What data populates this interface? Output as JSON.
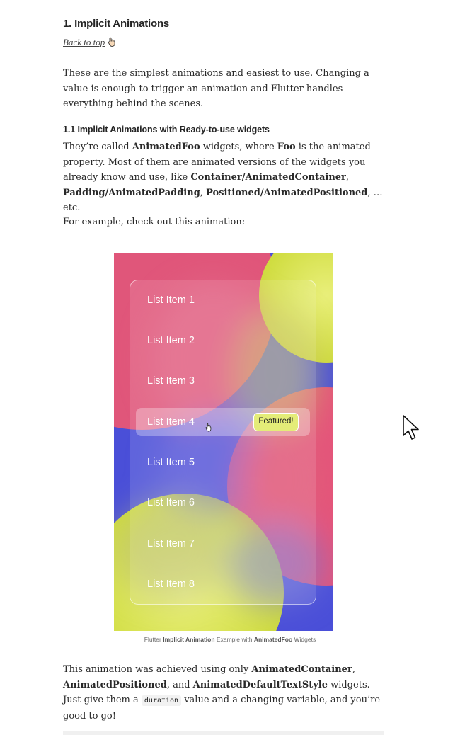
{
  "section": {
    "heading": "1. Implicit Animations",
    "back_to_top": "Back to top",
    "intro": "These are the simplest animations and easiest to use. Changing a value is enough to trigger an animation and Flutter handles everything behind the scenes.",
    "subheading": "1.1 Implicit Animations with Ready-to-use widgets",
    "p1": {
      "t1": "They’re called ",
      "b1": "AnimatedFoo",
      "t2": " widgets, where ",
      "b2": "Foo",
      "t3": " is the animated property. Most of them are animated versions of the widgets you already know and use, like ",
      "b3": "Container/AnimatedContainer",
      "t4": ", ",
      "b4": "Padding/AnimatedPadding",
      "t5": ", ",
      "b5": "Positioned/AnimatedPositioned",
      "t6": ", …etc."
    },
    "p2": "For example, check out this animation:",
    "demo": {
      "items": [
        "List Item 1",
        "List Item 2",
        "List Item 3",
        "List Item 4",
        "List Item 5",
        "List Item 6",
        "List Item 7",
        "List Item 8"
      ],
      "featured_label": "Featured!"
    },
    "caption": {
      "t1": "Flutter ",
      "b1": "Implicit Animation",
      "t2": " Example with ",
      "b2": "AnimatedFoo",
      "t3": " Widgets"
    },
    "p3": {
      "t1": "This animation was achieved using only ",
      "b1": "AnimatedContainer",
      "t2": ", ",
      "b2": "AnimatedPositioned",
      "t3": ", and ",
      "b3": "AnimatedDefaultTextStyle",
      "t4": " widgets. Just give them a ",
      "code": "duration",
      "t5": " value and a changing variable, and you’re good to go!"
    }
  },
  "icons": {
    "back_to_top_icon": "pointing-hand-icon",
    "demo_cursor": "hand-cursor-icon",
    "page_cursor": "arrow-cursor-icon"
  },
  "colors": {
    "text": "#292929",
    "demo_blue": "#4a4fd8",
    "demo_pink": "#e0567a",
    "demo_yellow": "#d4e04a",
    "badge": "#e4ec78"
  }
}
